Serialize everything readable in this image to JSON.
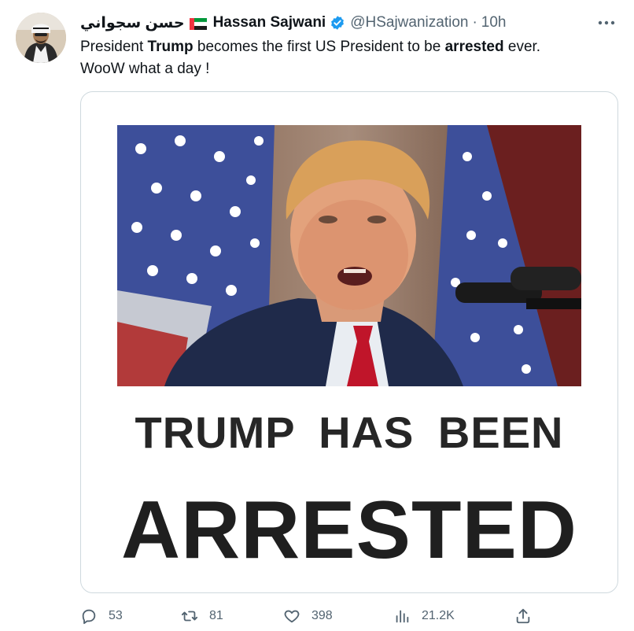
{
  "author": {
    "name_arabic": "حسن سجواني",
    "name": "Hassan Sajwani",
    "handle": "@HSajwanization",
    "separator": "·",
    "time": "10h",
    "flag_icon": "uae-flag-icon",
    "verified_icon": "verified-badge-icon"
  },
  "tweet": {
    "part1": "President ",
    "bold1": "Trump",
    "part2": " becomes the first US President to be ",
    "bold2": "arrested",
    "part3": " ever.",
    "line2": "WooW what a day !"
  },
  "media": {
    "line1": "TRUMP HAS BEEN",
    "line2": "ARRESTED"
  },
  "actions": {
    "replies": "53",
    "retweets": "81",
    "likes": "398",
    "views": "21.2K"
  },
  "colors": {
    "text": "#0f1419",
    "secondary": "#536471",
    "border": "#cfd9de",
    "verified": "#1d9bf0"
  }
}
